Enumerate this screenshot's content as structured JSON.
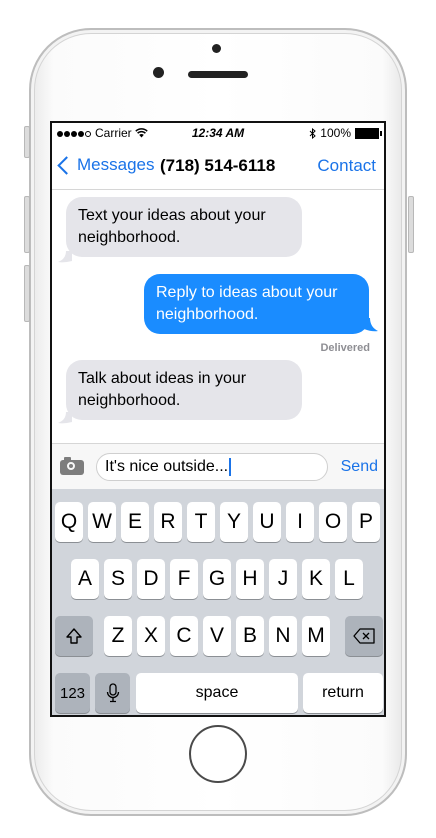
{
  "status": {
    "carrier": "Carrier",
    "time": "12:34 AM",
    "battery": "100%"
  },
  "navbar": {
    "back_label": "Messages",
    "title": "(718) 514-6118",
    "contact_label": "Contact"
  },
  "messages": [
    {
      "direction": "incoming",
      "text": "Text your ideas about your neighborhood."
    },
    {
      "direction": "outgoing",
      "text": "Reply to ideas about your neighborhood."
    },
    {
      "direction": "incoming",
      "text": "Talk about ideas in your neighborhood."
    }
  ],
  "delivered_label": "Delivered",
  "composer": {
    "value": "It's nice outside...",
    "send_label": "Send"
  },
  "keyboard": {
    "row1": [
      "Q",
      "W",
      "E",
      "R",
      "T",
      "Y",
      "U",
      "I",
      "O",
      "P"
    ],
    "row2": [
      "A",
      "S",
      "D",
      "F",
      "G",
      "H",
      "J",
      "K",
      "L"
    ],
    "row3": [
      "Z",
      "X",
      "C",
      "V",
      "B",
      "N",
      "M"
    ],
    "numbers_label": "123",
    "space_label": "space",
    "return_label": "return"
  },
  "colors": {
    "accent": "#1a73e8",
    "outgoing_bubble": "#1a8cff",
    "incoming_bubble": "#e5e5ea"
  }
}
